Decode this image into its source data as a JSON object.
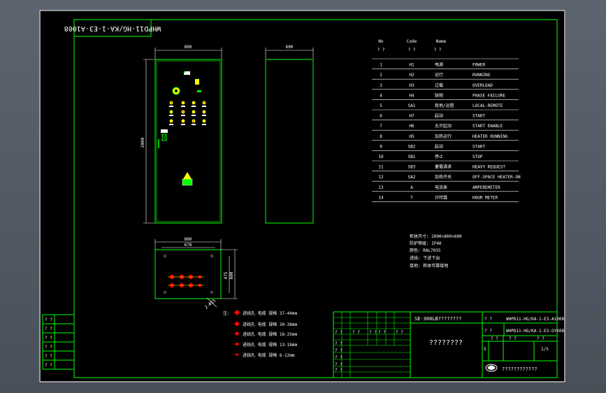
{
  "drawing_code_rotated": "WHPD11-HG/KA-1-E3-A1008",
  "front": {
    "width_label": "800",
    "height_label": "2000"
  },
  "side": {
    "width_label": "600"
  },
  "plan": {
    "width_label": "800",
    "inner_label": "678",
    "depth_label": "600",
    "side_label": "475",
    "angle_label": "2-Ф15"
  },
  "bom": {
    "headers": {
      "no": "Nn",
      "code": "Code",
      "name": "Name"
    },
    "subheaders": {
      "no": "? ?",
      "code": "? ?",
      "name": "? ?"
    },
    "rows": [
      {
        "no": "1",
        "code": "H1",
        "cn": "电源",
        "en": "POWER"
      },
      {
        "no": "2",
        "code": "H2",
        "cn": "运行",
        "en": "RUNNING"
      },
      {
        "no": "3",
        "code": "H3",
        "cn": "过载",
        "en": "OVERLOAD"
      },
      {
        "no": "4",
        "code": "H4",
        "cn": "缺相",
        "en": "PHASE FAILURE"
      },
      {
        "no": "5",
        "code": "SA1",
        "cn": "就地/远程",
        "en": "LOCAL-REMOTE"
      },
      {
        "no": "6",
        "code": "H7",
        "cn": "起动",
        "en": "START"
      },
      {
        "no": "7",
        "code": "H6",
        "cn": "允许起动",
        "en": "START ENABLE"
      },
      {
        "no": "8",
        "code": "H5",
        "cn": "加热运行",
        "en": "HEATER RUNNING"
      },
      {
        "no": "9",
        "code": "SB2",
        "cn": "起动",
        "en": "START"
      },
      {
        "no": "10",
        "code": "SB1",
        "cn": "停止",
        "en": "STOP"
      },
      {
        "no": "11",
        "code": "SB3",
        "cn": "重载请求",
        "en": "HEAVY REQUEST"
      },
      {
        "no": "12",
        "code": "SA2",
        "cn": "加热开关",
        "en": "OFF-SPACE HEATER-ON"
      },
      {
        "no": "13",
        "code": "A",
        "cn": "电流表",
        "en": "AMPEREMETER"
      },
      {
        "no": "14",
        "code": "T",
        "cn": "计时器",
        "en": "HOUR METER"
      }
    ]
  },
  "notes": [
    "柜体尺寸: 2000×800×600",
    "防护等级: IP40",
    "颜色: RAL7035",
    "进线: 下进下出",
    "接地: 柜体可靠接地"
  ],
  "cable_legend": {
    "prefix": "注:",
    "items": [
      {
        "text": "进线孔 电缆 规格 37-44mm"
      },
      {
        "text": "进线孔 电缆 规格 30-38mm"
      },
      {
        "text": "进线孔 电缆 规格 18-25mm"
      },
      {
        "text": "进线孔 电缆 规格 13-18mm"
      },
      {
        "text": "进线孔 电缆 规格 6-12mm"
      }
    ]
  },
  "revision_cells": [
    "? ?",
    "? ?",
    "? ?",
    "? ?",
    "? ?",
    "? ?"
  ],
  "title_block": {
    "model": "SE-300LB????????",
    "code1": "WHPD11-HG/KA-1-E3-A1008",
    "code2": "WHPD11-HG/KA-1-E3-GYK08",
    "title": "????????",
    "company": "????????????",
    "scale": "1/5",
    "sheet_marker": "S",
    "cell": "? ?"
  },
  "colors": {
    "line": "#00ff00",
    "text": "#ffffff",
    "accent": "#ffff00",
    "hole": "#ff0000"
  }
}
